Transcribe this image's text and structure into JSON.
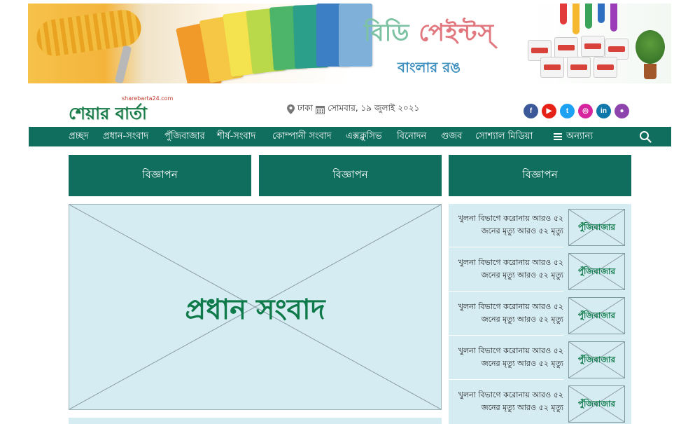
{
  "banner": {
    "brand_part1": "বিডি",
    "brand_part2": "পেইন্টস্",
    "brand_tagline": "বাংলার রঙ"
  },
  "header": {
    "logo_text": "শেয়ার বার্তা",
    "logo_url": "sharebarta24.com",
    "location": "ঢাকা",
    "date": "সোমবার, ১৯ জুলাই ২০২১",
    "socials": [
      {
        "name": "facebook",
        "glyph": "f",
        "color": "#3b5998"
      },
      {
        "name": "youtube",
        "glyph": "▶",
        "color": "#e62117"
      },
      {
        "name": "twitter",
        "glyph": "t",
        "color": "#1da1f2"
      },
      {
        "name": "instagram",
        "glyph": "◎",
        "color": "#d6249f"
      },
      {
        "name": "linkedin",
        "glyph": "in",
        "color": "#0e76a8"
      },
      {
        "name": "podcast",
        "glyph": "●",
        "color": "#8e44ad"
      }
    ]
  },
  "nav": {
    "items": [
      "প্রচ্ছদ",
      "প্রধান-সংবাদ",
      "পুঁজিবাজার",
      "শীর্ষ-সংবাদ",
      "কোম্পানী সংবাদ",
      "এক্সক্লুসিভ",
      "বিনোদন",
      "গুজব",
      "সোশ্যাল মিডিয়া"
    ],
    "more": "অন্যান্য"
  },
  "ads": [
    "বিজ্ঞাপন",
    "বিজ্ঞাপন",
    "বিজ্ঞাপন"
  ],
  "lead": {
    "title": "প্রধান সংবাদ"
  },
  "sidebar": {
    "items": [
      {
        "line1": "খুলনা বিভাগে করোনায় আরও ৫২",
        "line2": "জনের মৃত্যু আরও ৫২ মৃত্যু",
        "thumb": "পুঁজিবাজার"
      },
      {
        "line1": "খুলনা বিভাগে করোনায় আরও ৫২",
        "line2": "জনের মৃত্যু আরও ৫২ মৃত্যু",
        "thumb": "পুঁজিবাজার"
      },
      {
        "line1": "খুলনা বিভাগে করোনায় আরও ৫২",
        "line2": "জনের মৃত্যু আরও ৫২ মৃত্যু",
        "thumb": "পুঁজিবাজার"
      },
      {
        "line1": "খুলনা বিভাগে করোনায় আরও ৫২",
        "line2": "জনের মৃত্যু আরও ৫২ মৃত্যু",
        "thumb": "পুঁজিবাজার"
      },
      {
        "line1": "খুলনা বিভাগে করোনায় আরও ৫২",
        "line2": "জনের মৃত্যু আরও ৫২ মৃত্যু",
        "thumb": "পুঁজিবাজার"
      }
    ]
  },
  "colors": {
    "primary": "#0f6e5d",
    "placeholder_bg": "#d6ecf3",
    "headline_green": "#0f7a4a"
  }
}
